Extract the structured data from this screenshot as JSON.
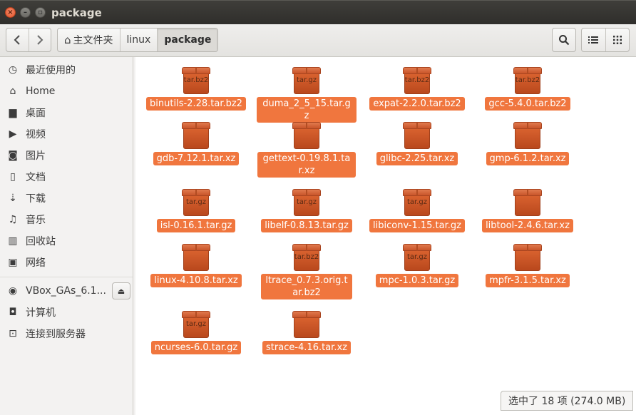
{
  "window": {
    "title": "package"
  },
  "toolbar": {
    "breadcrumbs": [
      {
        "label": "主文件夹",
        "home": true
      },
      {
        "label": "linux"
      },
      {
        "label": "package",
        "active": true
      }
    ]
  },
  "sidebar": {
    "places": [
      {
        "label": "最近使用的",
        "icon": "clock-icon",
        "glyph": "◷"
      },
      {
        "label": "Home",
        "icon": "home-icon",
        "glyph": "⌂"
      },
      {
        "label": "桌面",
        "icon": "folder-icon",
        "glyph": "▆"
      },
      {
        "label": "视频",
        "icon": "video-icon",
        "glyph": "▶"
      },
      {
        "label": "图片",
        "icon": "camera-icon",
        "glyph": "◙"
      },
      {
        "label": "文档",
        "icon": "document-icon",
        "glyph": "▯"
      },
      {
        "label": "下载",
        "icon": "download-icon",
        "glyph": "⇣"
      },
      {
        "label": "音乐",
        "icon": "music-icon",
        "glyph": "♫"
      },
      {
        "label": "回收站",
        "icon": "trash-icon",
        "glyph": "▥"
      },
      {
        "label": "网络",
        "icon": "network-icon",
        "glyph": "▣"
      }
    ],
    "devices": [
      {
        "label": "VBox_GAs_6.1...",
        "icon": "disc-icon",
        "glyph": "◉",
        "eject": true
      },
      {
        "label": "计算机",
        "icon": "computer-icon",
        "glyph": "◘"
      },
      {
        "label": "连接到服务器",
        "icon": "server-icon",
        "glyph": "⊡"
      }
    ]
  },
  "files": [
    {
      "name": "binutils-2.28.tar.bz2",
      "tag": "tar.bz2"
    },
    {
      "name": "duma_2_5_15.tar.gz",
      "tag": "tar.gz"
    },
    {
      "name": "expat-2.2.0.tar.bz2",
      "tag": "tar.bz2"
    },
    {
      "name": "gcc-5.4.0.tar.bz2",
      "tag": "tar.bz2"
    },
    {
      "name": "gdb-7.12.1.tar.xz",
      "tag": ""
    },
    {
      "name": "gettext-0.19.8.1.tar.xz",
      "tag": ""
    },
    {
      "name": "glibc-2.25.tar.xz",
      "tag": ""
    },
    {
      "name": "gmp-6.1.2.tar.xz",
      "tag": ""
    },
    {
      "name": "isl-0.16.1.tar.gz",
      "tag": "tar.gz"
    },
    {
      "name": "libelf-0.8.13.tar.gz",
      "tag": "tar.gz"
    },
    {
      "name": "libiconv-1.15.tar.gz",
      "tag": "tar.gz"
    },
    {
      "name": "libtool-2.4.6.tar.xz",
      "tag": ""
    },
    {
      "name": "linux-4.10.8.tar.xz",
      "tag": ""
    },
    {
      "name": "ltrace_0.7.3.orig.tar.bz2",
      "tag": "tar.bz2"
    },
    {
      "name": "mpc-1.0.3.tar.gz",
      "tag": "tar.gz"
    },
    {
      "name": "mpfr-3.1.5.tar.xz",
      "tag": ""
    },
    {
      "name": "ncurses-6.0.tar.gz",
      "tag": "tar.gz"
    },
    {
      "name": "strace-4.16.tar.xz",
      "tag": ""
    }
  ],
  "status": {
    "text": "选中了 18 项 (274.0 MB)"
  },
  "colors": {
    "selection": "#f0763e",
    "titlebar": "#3c3b37"
  }
}
